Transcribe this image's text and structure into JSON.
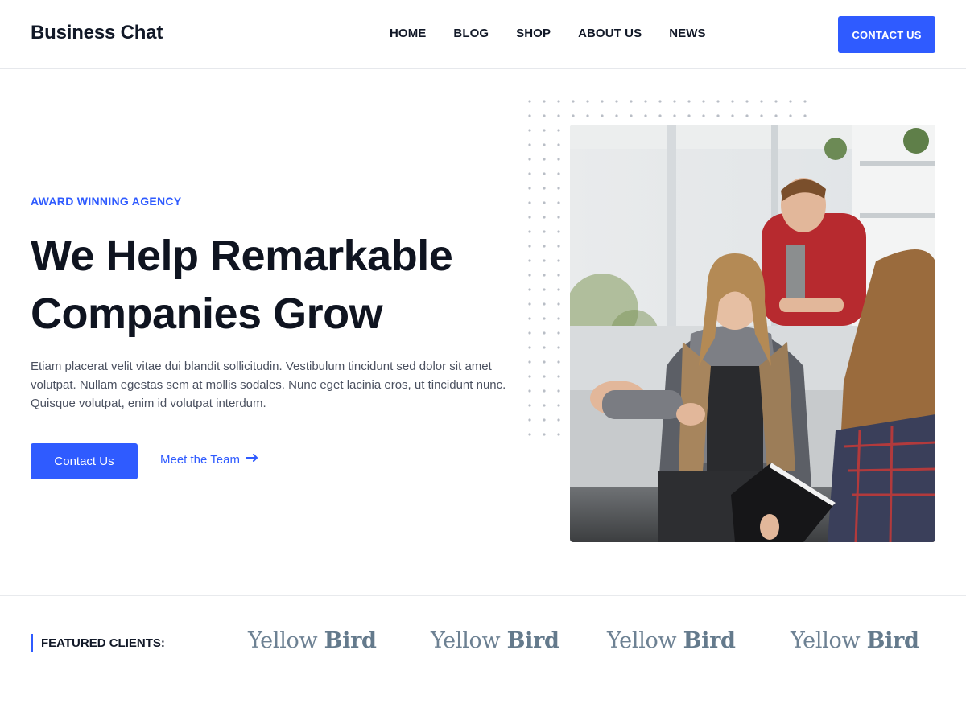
{
  "header": {
    "logo": "Business Chat",
    "nav": [
      "HOME",
      "BLOG",
      "SHOP",
      "ABOUT US",
      "NEWS"
    ],
    "cta_label": "CONTACT US"
  },
  "hero": {
    "eyebrow": "AWARD WINNING AGENCY",
    "title_line1": "We Help Remarkable",
    "title_line2": "Companies Grow",
    "description": "Etiam placerat velit vitae dui blandit sollicitudin. Vestibulum tincidunt sed dolor sit amet volutpat. Nullam egestas sem at mollis sodales. Nunc eget lacinia eros, ut tincidunt nunc. Quisque volutpat, enim id volutpat interdum.",
    "primary_button": "Contact Us",
    "secondary_link": "Meet the Team"
  },
  "clients": {
    "label": "FEATURED CLIENTS:",
    "logos": [
      {
        "light": "Yellow",
        "bold": "Bird"
      },
      {
        "light": "Yellow",
        "bold": "Bird"
      },
      {
        "light": "Yellow",
        "bold": "Bird"
      },
      {
        "light": "Yellow",
        "bold": "Bird"
      }
    ]
  },
  "colors": {
    "accent": "#2f5bff",
    "text": "#0f1420",
    "muted": "#4b5160",
    "client_logo": "#6d8193"
  },
  "icons": {
    "arrow": "arrow-right-icon"
  }
}
